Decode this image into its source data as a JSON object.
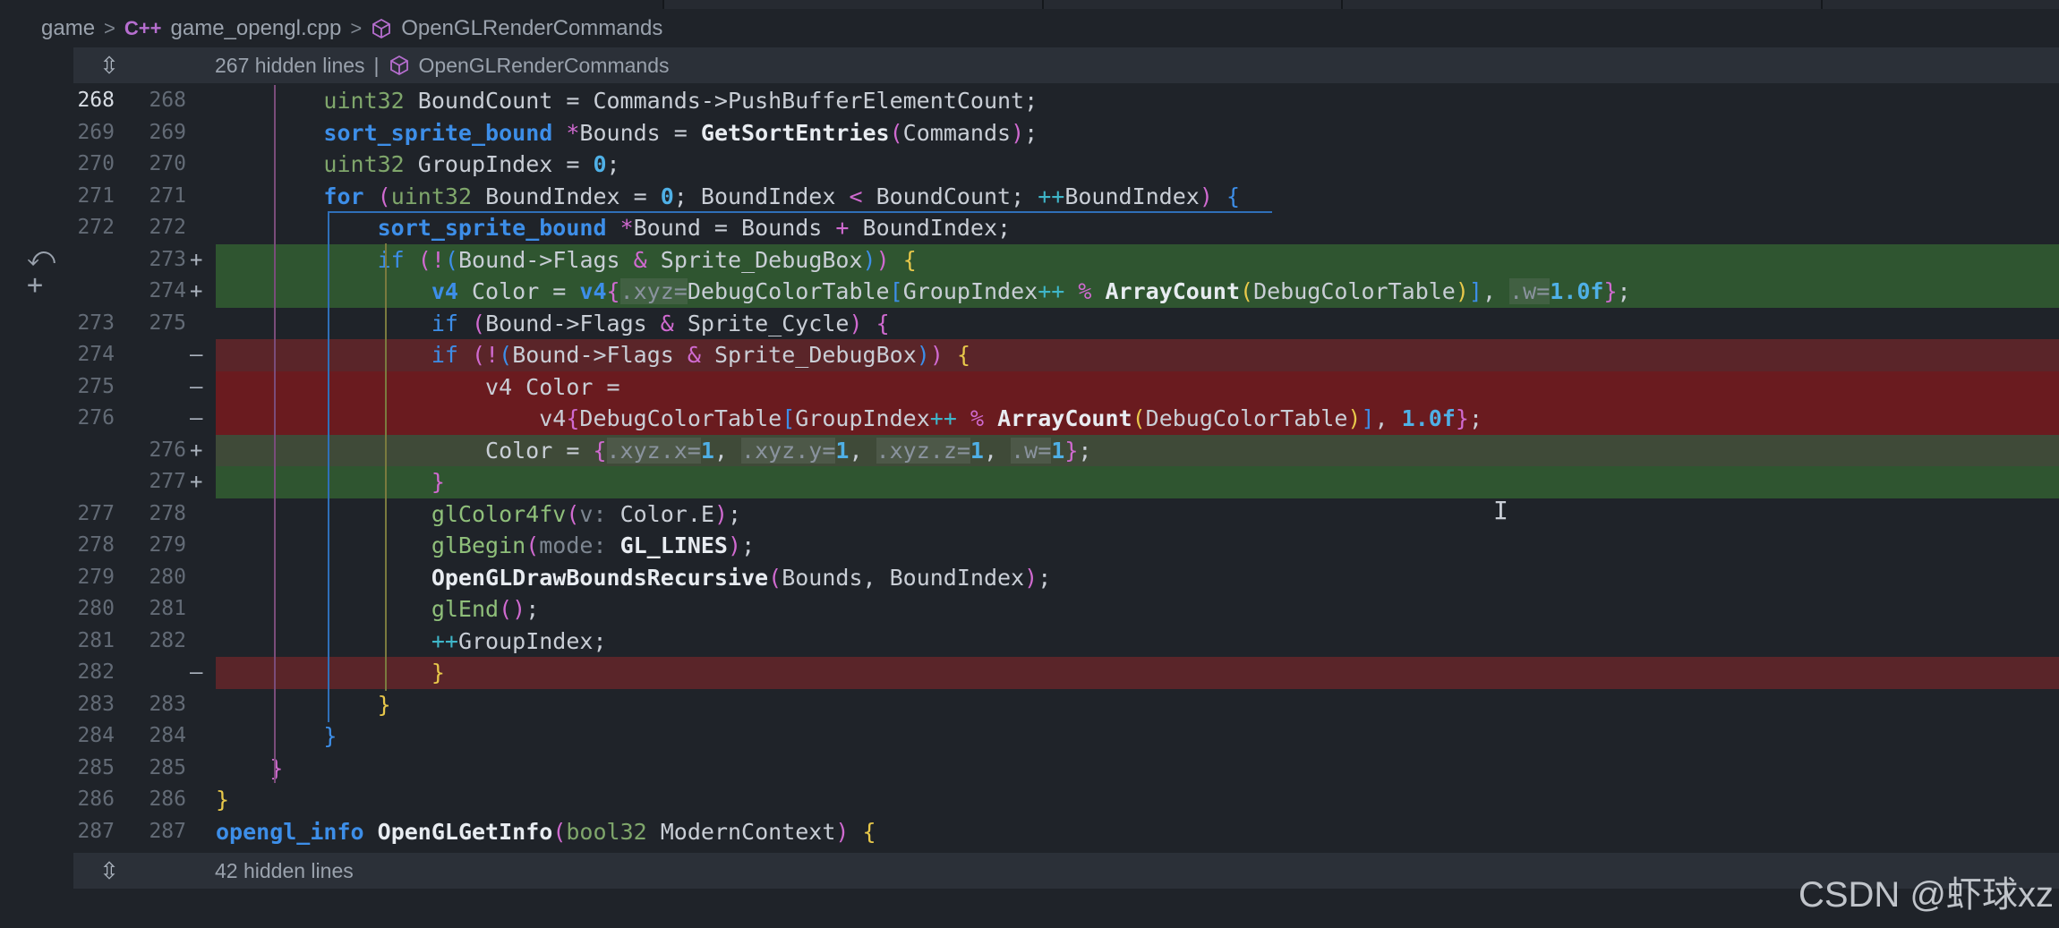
{
  "breadcrumb": {
    "folder": "game",
    "file_icon": "C++",
    "file": "game_opengl.cpp",
    "symbol": "OpenGLRenderCommands"
  },
  "hidden_top": {
    "text": "267 hidden lines",
    "sep": "|",
    "symbol": "OpenGLRenderCommands"
  },
  "hidden_bottom": {
    "text": "42 hidden lines"
  },
  "watermark": "CSDN @虾球xz",
  "lines": [
    {
      "old": "268",
      "new": "268",
      "mark": ""
    },
    {
      "old": "269",
      "new": "269",
      "mark": ""
    },
    {
      "old": "270",
      "new": "270",
      "mark": ""
    },
    {
      "old": "271",
      "new": "271",
      "mark": ""
    },
    {
      "old": "272",
      "new": "272",
      "mark": ""
    },
    {
      "old": "",
      "new": "273",
      "mark": "+"
    },
    {
      "old": "",
      "new": "274",
      "mark": "+"
    },
    {
      "old": "273",
      "new": "275",
      "mark": ""
    },
    {
      "old": "274",
      "new": "",
      "mark": "—"
    },
    {
      "old": "275",
      "new": "",
      "mark": "—"
    },
    {
      "old": "276",
      "new": "",
      "mark": "—"
    },
    {
      "old": "",
      "new": "276",
      "mark": "+"
    },
    {
      "old": "",
      "new": "277",
      "mark": "+"
    },
    {
      "old": "277",
      "new": "278",
      "mark": ""
    },
    {
      "old": "278",
      "new": "279",
      "mark": ""
    },
    {
      "old": "279",
      "new": "280",
      "mark": ""
    },
    {
      "old": "280",
      "new": "281",
      "mark": ""
    },
    {
      "old": "281",
      "new": "282",
      "mark": ""
    },
    {
      "old": "282",
      "new": "",
      "mark": "—"
    },
    {
      "old": "283",
      "new": "283",
      "mark": ""
    },
    {
      "old": "284",
      "new": "284",
      "mark": ""
    },
    {
      "old": "285",
      "new": "285",
      "mark": ""
    },
    {
      "old": "286",
      "new": "286",
      "mark": ""
    },
    {
      "old": "287",
      "new": "287",
      "mark": ""
    }
  ]
}
